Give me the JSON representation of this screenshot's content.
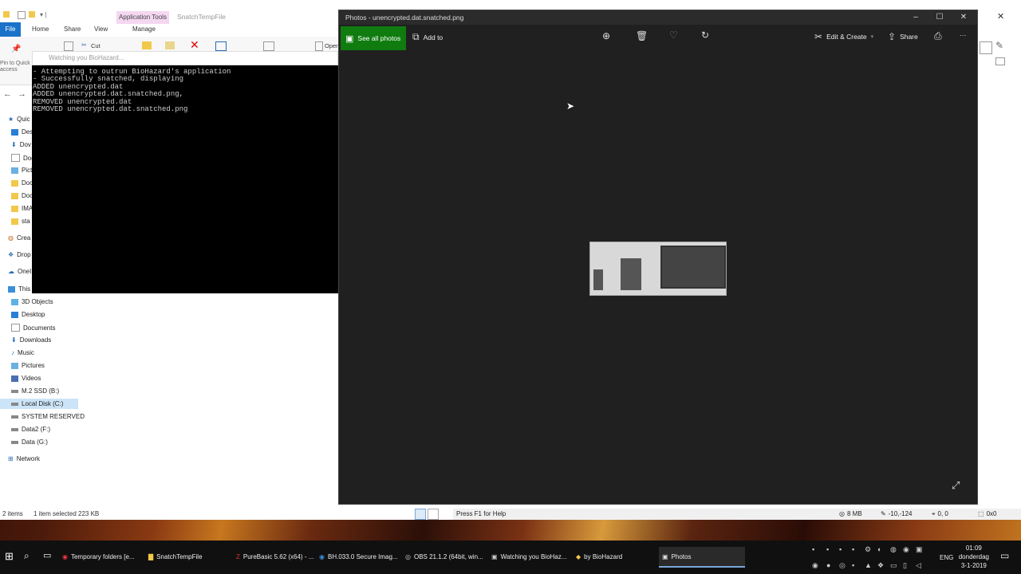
{
  "explorer": {
    "title": "SnatchTempFile",
    "ribbon_context_tab": "Application Tools",
    "tabs": [
      "File",
      "Home",
      "Share",
      "View",
      "Manage"
    ],
    "ribbon_cut": "Cut",
    "ribbon_pin": "Pin to Quick access",
    "ribbon_open": "Open",
    "quick_partial": "Quic",
    "partial_items": [
      "Des",
      "Dov",
      "Doc",
      "Pict",
      "Doc",
      "Doc",
      "IMA",
      "sta"
    ],
    "create_partial": "Crea",
    "dropbox_partial": "Drop",
    "onedrive_partial": "OneI",
    "nav": [
      "This PC",
      "3D Objects",
      "Desktop",
      "Documents",
      "Downloads",
      "Music",
      "Pictures",
      "Videos",
      "M.2 SSD (B:)",
      "Local Disk (C:)",
      "SYSTEM RESERVED",
      "Data2 (F:)",
      "Data (G:)",
      "Network"
    ],
    "status_items": "2 items",
    "status_selected": "1 item selected  223 KB"
  },
  "console": {
    "title": "Watching you BioHazard...",
    "lines": [
      "- Attempting to outrun BioHazard's application",
      "- Successfully snatched, displaying",
      "ADDED unencrypted.dat",
      "ADDED unencrypted.dat.snatched.png,",
      "REMOVED unencrypted.dat",
      "REMOVED unencrypted.dat.snatched.png"
    ]
  },
  "photos": {
    "title": "Photos - unencrypted.dat.snatched.png",
    "see_all": "See all photos",
    "add_to": "Add to",
    "edit_create": "Edit & Create",
    "share": "Share",
    "more": "···"
  },
  "bg_status": {
    "help": "Press F1 for Help",
    "mem": "8 MB",
    "coords": "-10,-124",
    "coords2": "0, 0",
    "size": "0x0"
  },
  "taskbar": {
    "tasks": [
      "Temporary folders [e...",
      "SnatchTempFile",
      "PureBasic 5.62 (x64) - ...",
      "BH.033.0 Secure Imag...",
      "OBS 21.1.2 (64bit, win...",
      "Watching you BioHaz...",
      "by BioHazard",
      "Photos"
    ],
    "lang": "ENG",
    "time": "01:09",
    "day": "donderdag",
    "date": "3-1-2019"
  }
}
